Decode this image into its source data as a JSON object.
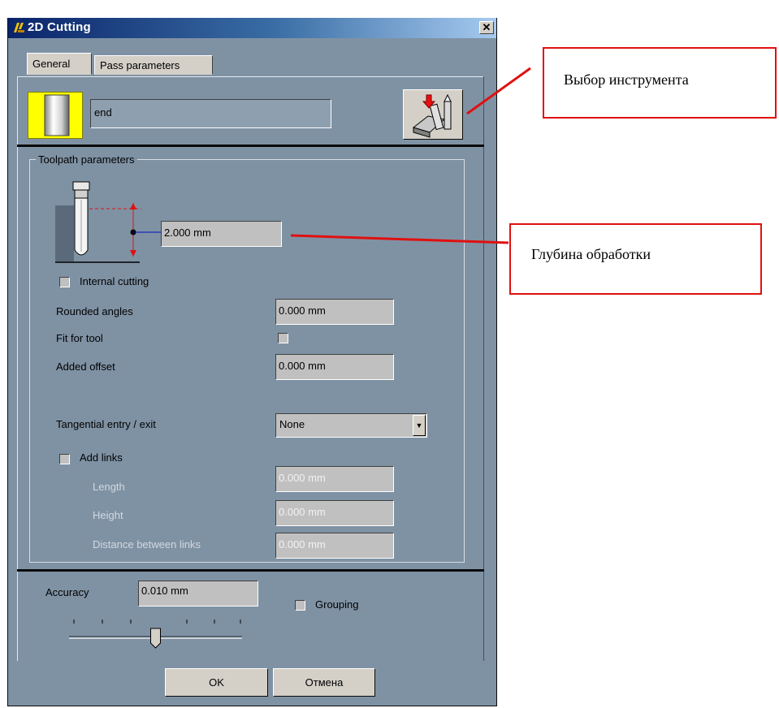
{
  "window": {
    "title": "2D Cutting",
    "close_glyph": "✕"
  },
  "tabs": [
    {
      "label": "General",
      "active": true
    },
    {
      "label": "Pass parameters",
      "active": false
    }
  ],
  "tool": {
    "name": "end"
  },
  "toolpath_group": {
    "title": "Toolpath parameters"
  },
  "depth": {
    "value": "2.000 mm"
  },
  "internal_cutting": {
    "label": "Internal cutting",
    "checked": false
  },
  "rounded_angles": {
    "label": "Rounded angles",
    "value": "0.000 mm"
  },
  "fit_for_tool": {
    "label": "Fit for tool",
    "checked": false
  },
  "added_offset": {
    "label": "Added offset",
    "value": "0.000 mm"
  },
  "tangential": {
    "label": "Tangential entry / exit",
    "selected": "None"
  },
  "add_links": {
    "label": "Add links",
    "checked": false,
    "length": {
      "label": "Length",
      "value": "0.000 mm"
    },
    "height": {
      "label": "Height",
      "value": "0.000 mm"
    },
    "distance": {
      "label": "Distance between links",
      "value": "0.000 mm"
    }
  },
  "accuracy": {
    "label": "Accuracy",
    "value": "0.010 mm",
    "slider_level": 0.5
  },
  "grouping": {
    "label": "Grouping",
    "checked": false
  },
  "buttons": {
    "ok": "OK",
    "cancel": "Отмена"
  },
  "annotations": {
    "tool_select": "Выбор инструмента",
    "depth": "Глубина обработки"
  },
  "colors": {
    "dialog_bg": "#7f92a4",
    "accent_red": "#e01010",
    "title_blue": "#0a246a",
    "tool_icon_yellow": "#ffff00"
  }
}
